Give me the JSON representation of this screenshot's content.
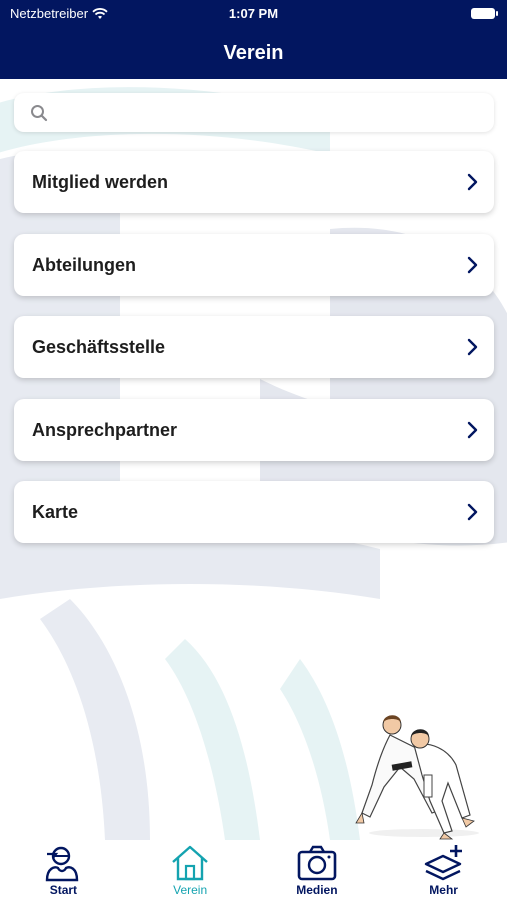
{
  "statusbar": {
    "carrier": "Netzbetreiber",
    "time": "1:07 PM"
  },
  "navbar": {
    "title": "Verein"
  },
  "search": {
    "placeholder": "",
    "value": ""
  },
  "menu": {
    "items": [
      {
        "label": "Mitglied werden"
      },
      {
        "label": "Abteilungen"
      },
      {
        "label": "Geschäftsstelle"
      },
      {
        "label": "Ansprechpartner"
      },
      {
        "label": "Karte"
      }
    ]
  },
  "tabbar": {
    "tabs": [
      {
        "label": "Start",
        "icon": "start-icon",
        "active": false
      },
      {
        "label": "Verein",
        "icon": "home-icon",
        "active": true
      },
      {
        "label": "Medien",
        "icon": "camera-icon",
        "active": false
      },
      {
        "label": "Mehr",
        "icon": "layers-plus-icon",
        "active": false
      }
    ]
  },
  "colors": {
    "primary": "#021660",
    "accent": "#14a3b0",
    "background_art": "#e6e9f0"
  }
}
